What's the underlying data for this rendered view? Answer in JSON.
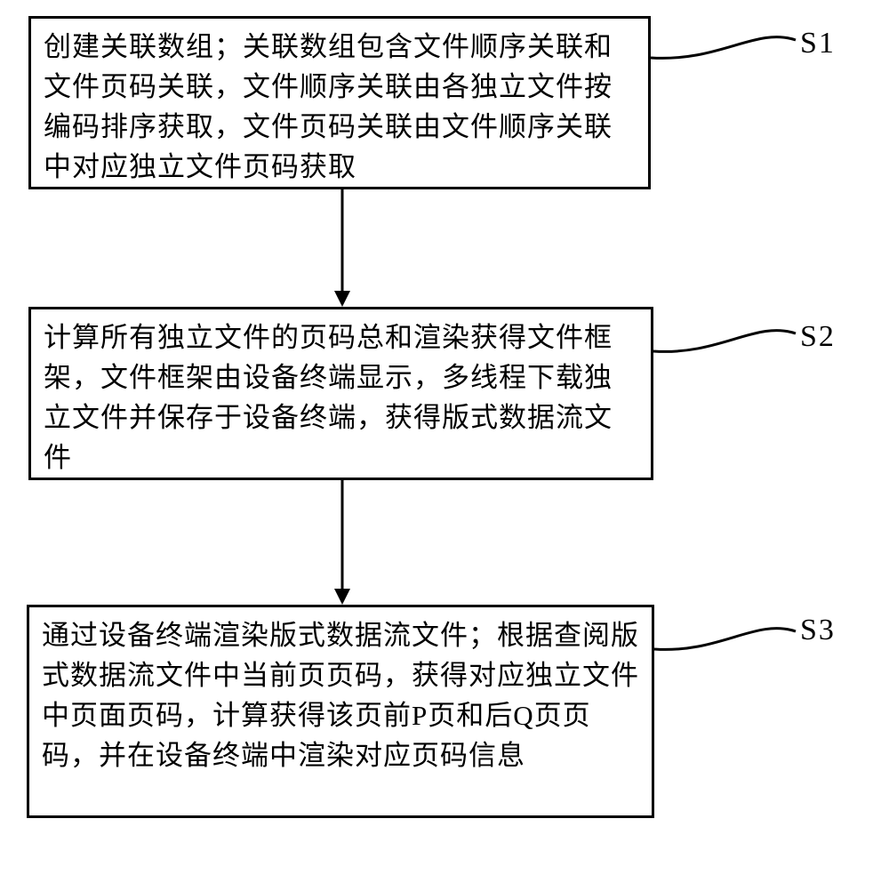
{
  "steps": [
    {
      "label": "S1",
      "text": "创建关联数组；关联数组包含文件顺序关联和文件页码关联，文件顺序关联由各独立文件按编码排序获取，文件页码关联由文件顺序关联中对应独立文件页码获取"
    },
    {
      "label": "S2",
      "text": "计算所有独立文件的页码总和渲染获得文件框架，文件框架由设备终端显示，多线程下载独立文件并保存于设备终端，获得版式数据流文件"
    },
    {
      "label": "S3",
      "text": "通过设备终端渲染版式数据流文件；根据查阅版式数据流文件中当前页页码，获得对应独立文件中页面页码，计算获得该页前P页和后Q页页码，并在设备终端中渲染对应页码信息"
    }
  ]
}
